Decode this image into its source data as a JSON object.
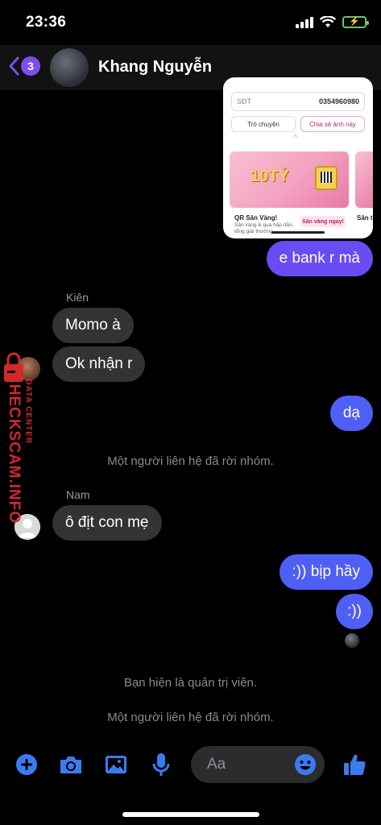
{
  "status": {
    "time": "23:36"
  },
  "header": {
    "back_badge": "3",
    "contact_name": "Khang Nguyễn"
  },
  "shared_card": {
    "phone_label": "SĐT",
    "phone_value": "0354960980",
    "btn_chat": "Trò chuyện",
    "btn_share": "Chia sẻ ảnh này",
    "promo_amount": "10TỶ",
    "promo_title": "QR Săn Vàng!",
    "promo_sub": "Săn vàng & quà hấp dẫn, tổng giải thưởng...",
    "promo_cta": "Săn vàng ngay!",
    "promo_side": "Săn t"
  },
  "messages": [
    {
      "kind": "out",
      "text": "e bank r mà"
    },
    {
      "kind": "sender",
      "text": "Kiên"
    },
    {
      "kind": "in",
      "text": "Momo à"
    },
    {
      "kind": "in",
      "text": "Ok nhận r"
    },
    {
      "kind": "out",
      "text": "dạ"
    },
    {
      "kind": "system",
      "text": "Một người liên hệ đã rời nhóm."
    },
    {
      "kind": "sender",
      "text": "Nam"
    },
    {
      "kind": "in",
      "text": "ô địt con mẹ"
    },
    {
      "kind": "out",
      "text": ":)) bịp hầy"
    },
    {
      "kind": "out",
      "text": ":))"
    },
    {
      "kind": "system",
      "text": "Bạn hiện là quản trị viên."
    },
    {
      "kind": "system",
      "text": "Một người liên hệ đã rời nhóm."
    }
  ],
  "watermark": {
    "main": "CHECKSCAM.INFO",
    "sub": "DATA CENTER"
  },
  "composer": {
    "placeholder": "Aa",
    "icons": [
      "plus-icon",
      "camera-icon",
      "image-icon",
      "mic-icon",
      "emoji-icon",
      "like-icon"
    ]
  },
  "colors": {
    "accent": "#6a4cf5",
    "accent2": "#4f5ff6",
    "incoming": "#333335",
    "icon_blue": "#3b7bf0",
    "watermark_red": "#d2282b"
  }
}
